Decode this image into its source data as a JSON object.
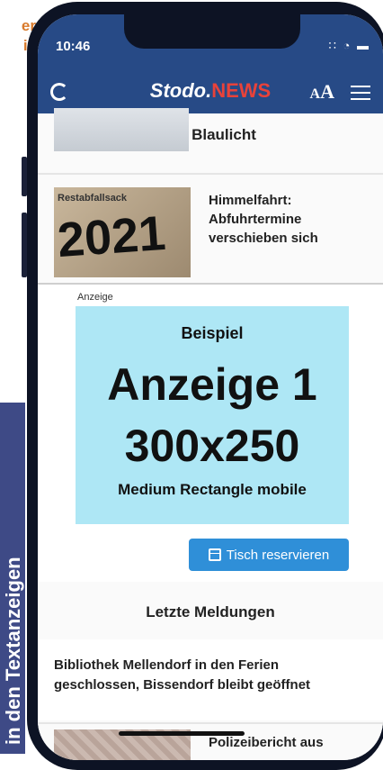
{
  "outer": {
    "side_text_1": "er",
    "side_text_2": "ie",
    "banner_text": "in den Textanzeigen"
  },
  "status_bar": {
    "time": "10:46",
    "icons": "∷ ◔ ▬"
  },
  "app_bar": {
    "logo_part1": "Stodo.",
    "logo_part2": "NEWS",
    "font_small": "A",
    "font_large": "A"
  },
  "sections": {
    "blaulicht": "Blaulicht",
    "item1": {
      "thumb_label": "Restabfallsack",
      "thumb_number": "2021",
      "title": "Himmelfahrt: Abfuhrtermine verschieben sich"
    }
  },
  "ad": {
    "label": "Anzeige",
    "line1": "Beispiel",
    "line2": "Anzeige 1",
    "line3": "300x250",
    "line4": "Medium Rectangle mobile",
    "button": "Tisch reservieren"
  },
  "latest": {
    "title": "Letzte Meldungen",
    "news1": "Bibliothek Mellendorf in den Ferien geschlossen, Bissendorf bleibt geöffnet",
    "news2": "Polizeibericht aus"
  },
  "colors": {
    "brand_blue": "#274a86",
    "news_red": "#e8423a",
    "ad_bg": "#aee7f5",
    "button_blue": "#2f8fd8"
  },
  "icons": [
    "back-icon",
    "menu-icon",
    "calendar-icon"
  ]
}
